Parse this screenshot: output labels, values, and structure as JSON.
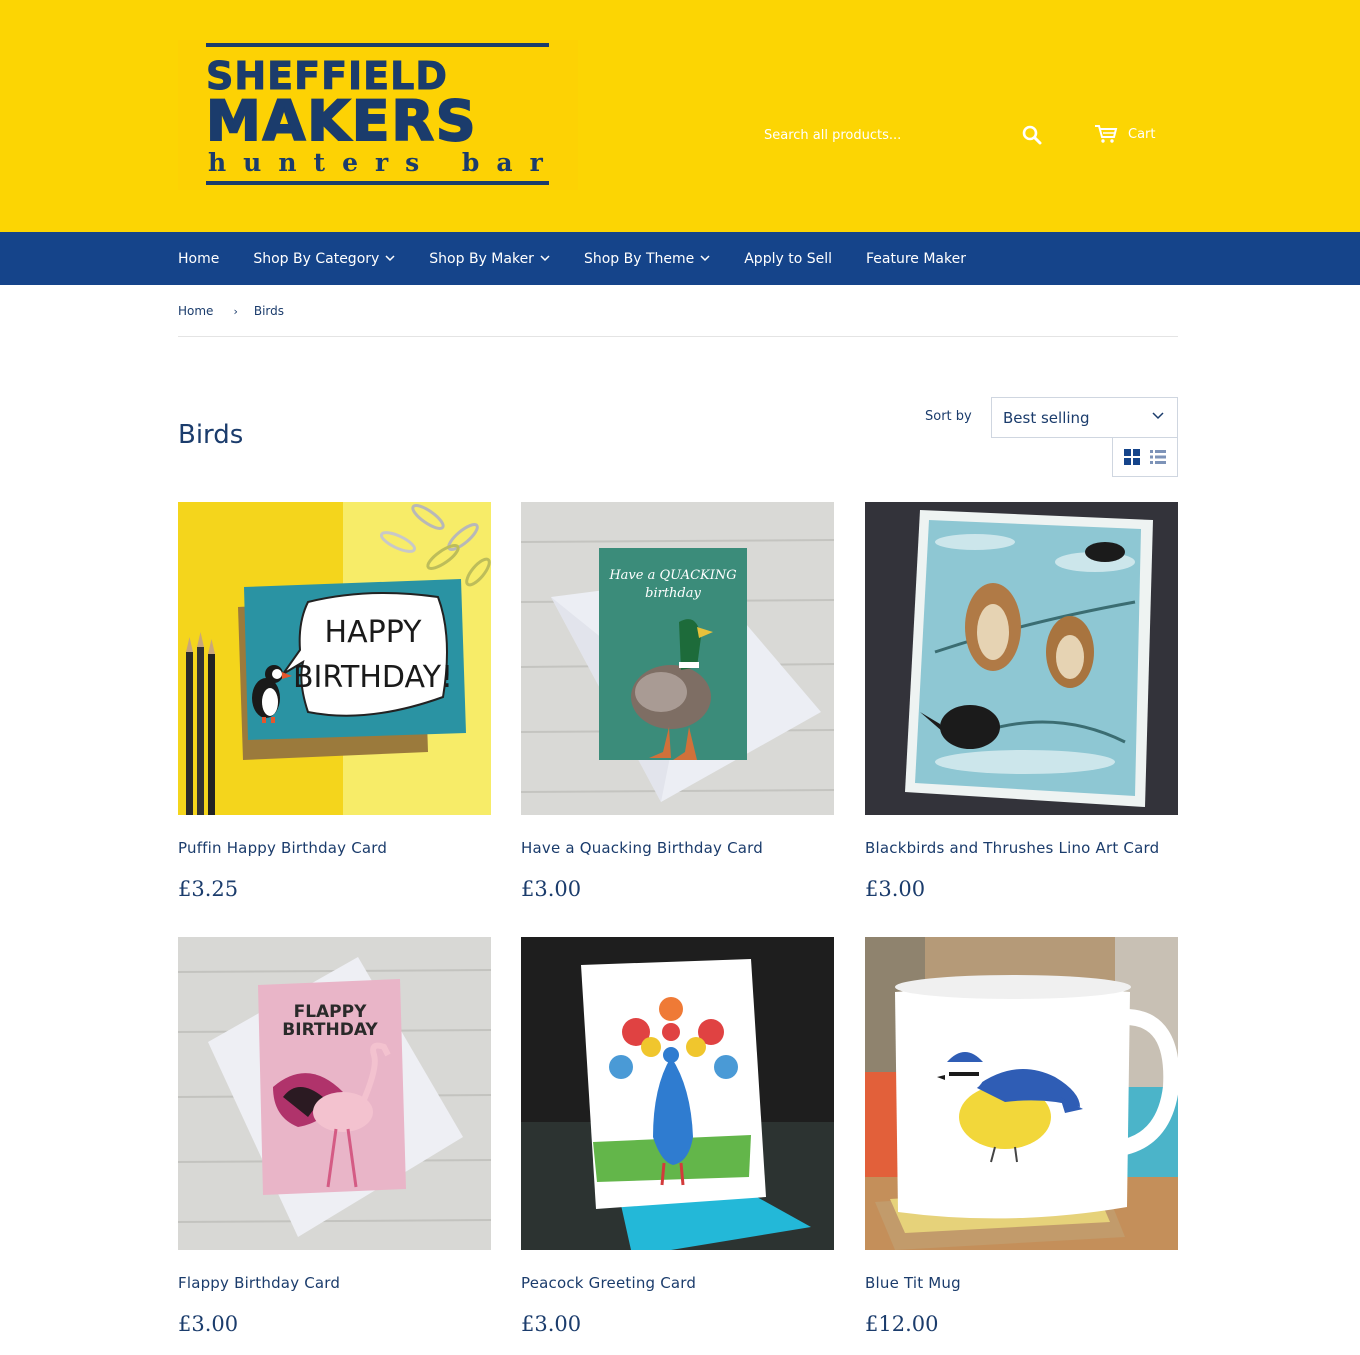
{
  "header": {
    "logo": {
      "line1": "SHEFFIELD",
      "line2": "MAKERS",
      "line3": "hunters bar"
    },
    "search": {
      "placeholder": "Search all products..."
    },
    "cart_label": "Cart"
  },
  "nav": {
    "items": [
      {
        "label": "Home",
        "dropdown": false
      },
      {
        "label": "Shop By Category",
        "dropdown": true
      },
      {
        "label": "Shop By Maker",
        "dropdown": true
      },
      {
        "label": "Shop By Theme",
        "dropdown": true
      },
      {
        "label": "Apply to Sell",
        "dropdown": false
      },
      {
        "label": "Feature Maker",
        "dropdown": false
      }
    ]
  },
  "breadcrumb": {
    "home": "Home",
    "separator": "›",
    "current": "Birds"
  },
  "collection": {
    "title": "Birds",
    "sort_label": "Sort by",
    "sort_value": "Best selling"
  },
  "products": [
    {
      "title": "Puffin Happy Birthday Card",
      "price": "£3.25",
      "image_text": [
        "HAPPY",
        "BIRTHDAY!"
      ]
    },
    {
      "title": "Have a Quacking Birthday Card",
      "price": "£3.00",
      "image_text": [
        "Have a QUACKING",
        "birthday"
      ]
    },
    {
      "title": "Blackbirds and Thrushes Lino Art Card",
      "price": "£3.00"
    },
    {
      "title": "Flappy Birthday Card",
      "price": "£3.00",
      "image_text": [
        "FLAPPY",
        "BIRTHDAY"
      ]
    },
    {
      "title": "Peacock Greeting Card",
      "price": "£3.00"
    },
    {
      "title": "Blue Tit Mug",
      "price": "£12.00"
    }
  ],
  "colors": {
    "header_bg": "#fcd503",
    "nav_bg": "#15448a",
    "text": "#1b3c6c"
  },
  "icons": [
    "search-icon",
    "cart-icon",
    "chevron-down-icon",
    "grid-view-icon",
    "list-view-icon"
  ]
}
